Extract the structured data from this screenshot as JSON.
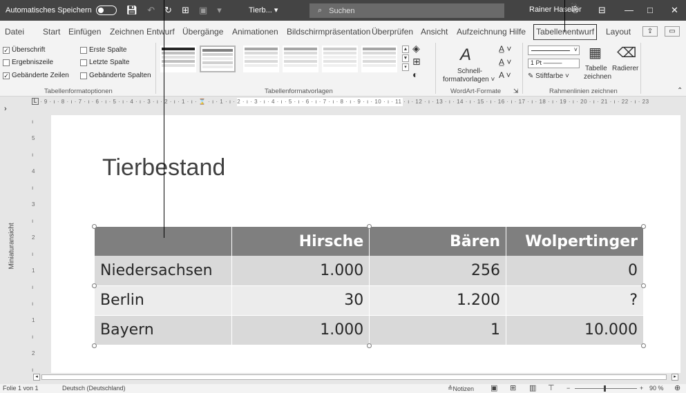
{
  "titlebar": {
    "autosave_label": "Automatisches Speichern",
    "doc_name": "Tierb... ▾",
    "search_placeholder": "Suchen",
    "user_name": "Rainer Haselier"
  },
  "tabs": [
    "Datei",
    "Start",
    "Einfügen",
    "Zeichnen",
    "Entwurf",
    "Übergänge",
    "Animationen",
    "Bildschirmpräsentation",
    "Überprüfen",
    "Ansicht",
    "Aufzeichnung",
    "Hilfe",
    "Tabellenentwurf",
    "Layout"
  ],
  "ribbon": {
    "options": {
      "header_row": "Überschrift",
      "first_column": "Erste Spalte",
      "total_row": "Ergebniszeile",
      "last_column": "Letzte Spalte",
      "banded_rows": "Gebänderte Zeilen",
      "banded_columns": "Gebänderte Spalten",
      "group_label": "Tabellenformatoptionen"
    },
    "styles_group_label": "Tabellenformatvorlagen",
    "wordart": {
      "quick_styles_line1": "Schnell-",
      "quick_styles_line2": "formatvorlagen ˅",
      "group_label": "WordArt-Formate"
    },
    "borders": {
      "pen_weight": "1 Pt",
      "pen_color": "Stiftfarbe ˅",
      "draw_table_line1": "Tabelle",
      "draw_table_line2": "zeichnen",
      "eraser": "Radierer",
      "group_label": "Rahmenlinien zeichnen"
    }
  },
  "rail": {
    "label": "Miniaturansicht"
  },
  "ruler": {
    "ticks": "· 9 · ı · 8 · ı · 7 · ı · 6 · ı · 5 · ı · 4 · ı · 3 · ı · 2 · ı · 1 · ı · ⌛ · ı · 1 · ı · 2 · ı · 3 · ı · 4 · ı · 5 · ı · 6 · ı · 7 · ı · 8 · ı · 9 · ı · 10 · ı · 11 · ı · 12 · ı · 13 · ı · 14 · ı · 15 · ı · 16 · ı · 17 · ı · 18 · ı · 19 · ı · 20 · ı · 21 · ı · 22 · ı · 23"
  },
  "slide": {
    "title": "Tierbestand",
    "table": {
      "headers": [
        "",
        "Hirsche",
        "Bären",
        "Wolpertinger"
      ],
      "rows": [
        [
          "Niedersachsen",
          "1.000",
          "256",
          "0"
        ],
        [
          "Berlin",
          "30",
          "1.200",
          "?"
        ],
        [
          "Bayern",
          "1.000",
          "1",
          "10.000"
        ]
      ]
    }
  },
  "status": {
    "slide_info": "Folie 1 von 1",
    "language": "Deutsch (Deutschland)",
    "notes": "Notizen",
    "zoom": "90 %"
  }
}
